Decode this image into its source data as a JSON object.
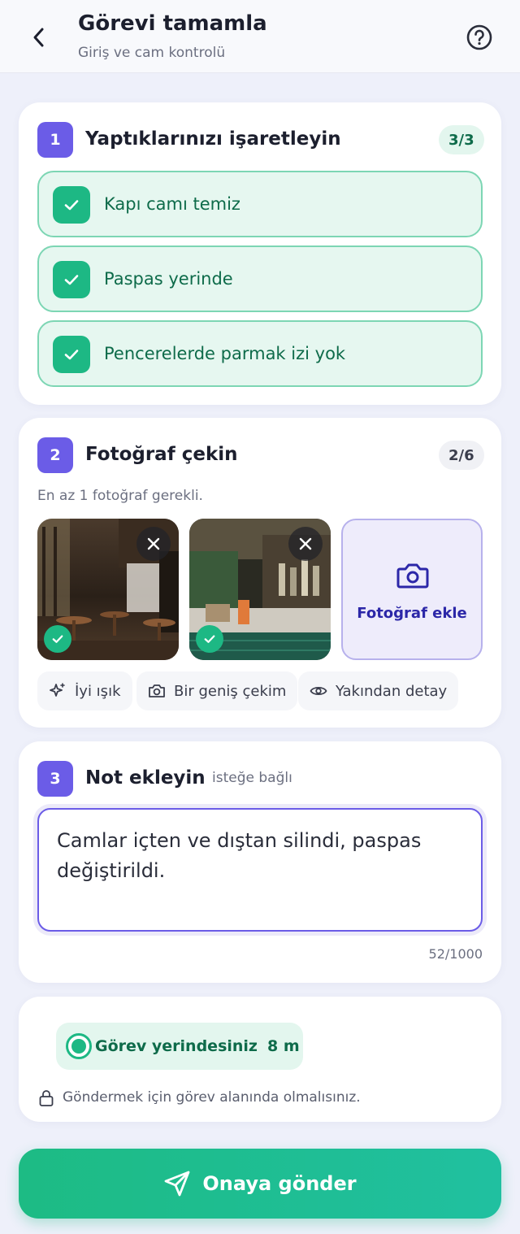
{
  "header": {
    "title": "Görevi tamamla",
    "subtitle": "Giriş ve cam kontrolü"
  },
  "section1": {
    "step": "1",
    "title": "Yaptıklarınızı işaretleyin",
    "count": "3/3",
    "items": [
      {
        "label": "Kapı camı temiz",
        "checked": true
      },
      {
        "label": "Paspas yerinde",
        "checked": true
      },
      {
        "label": "Pencerelerde parmak izi yok",
        "checked": true
      }
    ]
  },
  "section2": {
    "step": "2",
    "title": "Fotoğraf çekin",
    "count": "2/6",
    "hint": "En az 1 fotoğraf gerekli.",
    "add_photo_label": "Fotoğraf ekle",
    "tips": [
      "İyi ışık",
      "Bir geniş çekim",
      "Yakından detay"
    ]
  },
  "section3": {
    "step": "3",
    "title": "Not ekleyin",
    "optional": "isteğe bağlı",
    "note": "Camlar içten ve dıştan silindi, paspas değiştirildi.",
    "char_count": "52/1000"
  },
  "location": {
    "status": "Görev yerindesiniz",
    "distance": "8 m",
    "notice": "Göndermek için görev alanında olmalısınız."
  },
  "submit": {
    "label": "Onaya gönder"
  },
  "colors": {
    "accent": "#6b5ce7",
    "success": "#1db884",
    "success_bg": "#e6f7f0"
  }
}
